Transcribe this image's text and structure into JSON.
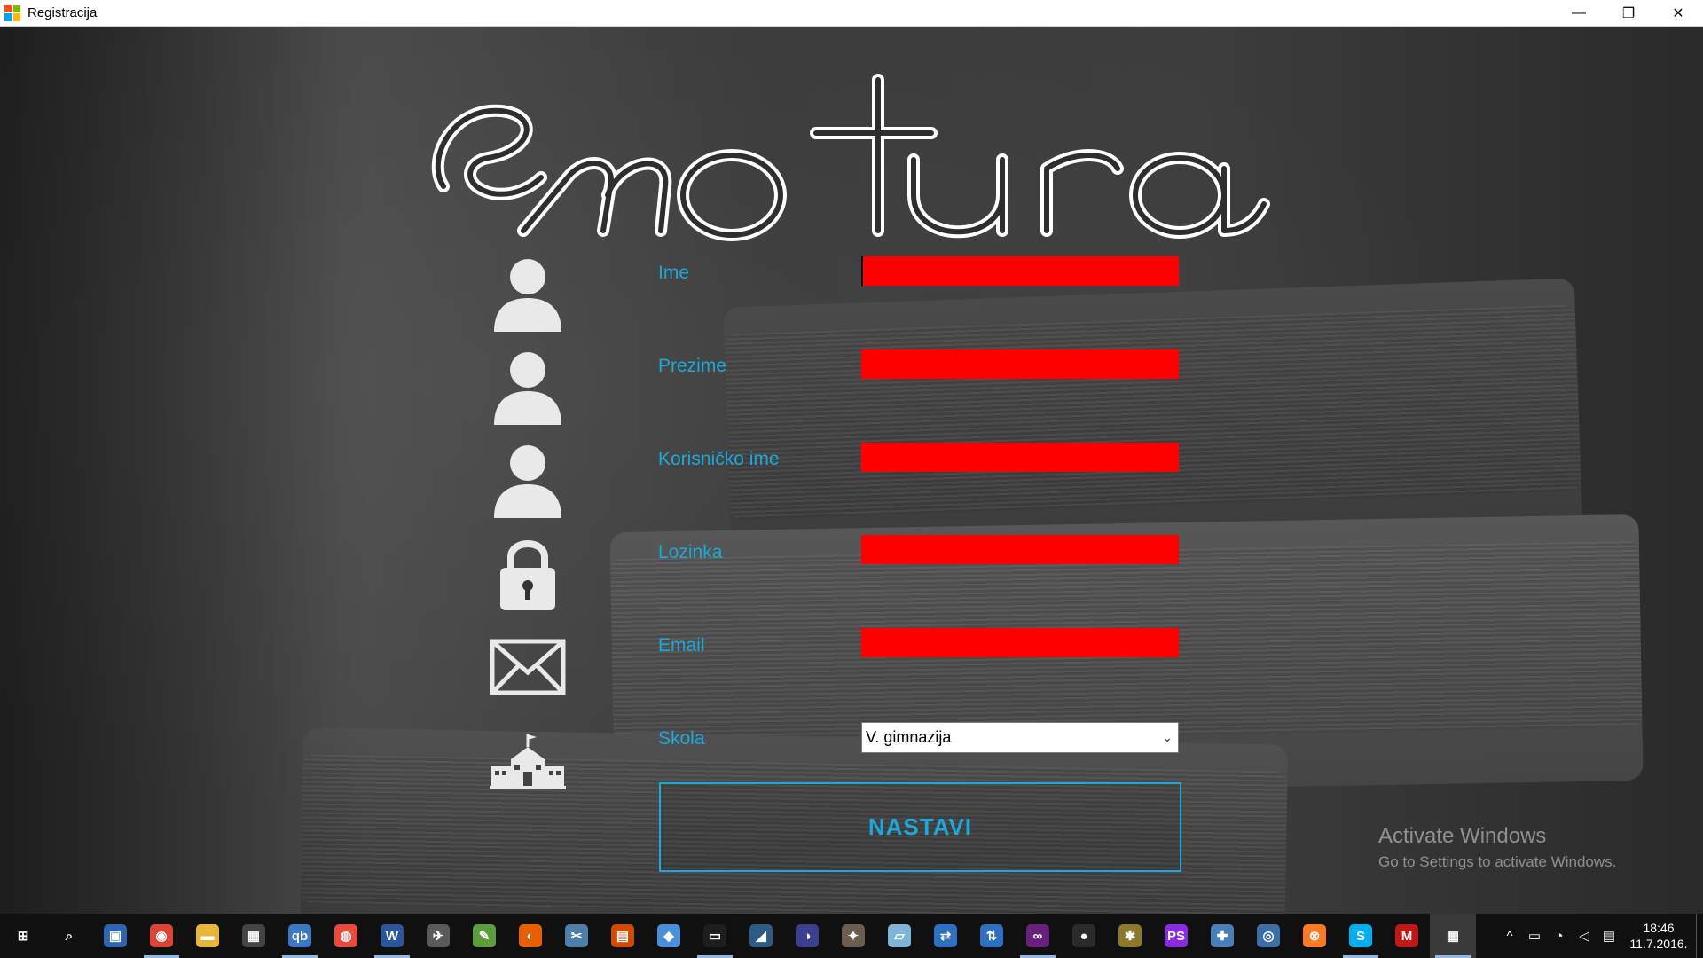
{
  "window": {
    "title": "Registracija",
    "controls": {
      "minimize": "—",
      "restore": "❐",
      "close": "✕"
    }
  },
  "logo": {
    "text": "ematura"
  },
  "form": {
    "fields": [
      {
        "label": "Ime",
        "value": "",
        "icon": "user-icon"
      },
      {
        "label": "Prezime",
        "value": "",
        "icon": "user-icon"
      },
      {
        "label": "Korisničko ime",
        "value": "",
        "icon": "user-icon"
      },
      {
        "label": "Lozinka",
        "value": "",
        "icon": "lock-icon"
      },
      {
        "label": "Email",
        "value": "",
        "icon": "mail-icon"
      }
    ],
    "school": {
      "label": "Skola",
      "selected": "V. gimnazija",
      "icon": "school-icon"
    },
    "submit_label": "NASTAVI",
    "field_color": "#ff0000",
    "accent_color": "#1da8d9"
  },
  "watermark": {
    "line1": "Activate Windows",
    "line2": "Go to Settings to activate Windows."
  },
  "taskbar": {
    "apps": [
      {
        "name": "start-button",
        "glyph": "⊞",
        "color": "#101010"
      },
      {
        "name": "search-icon",
        "glyph": "⌕",
        "color": "#101010"
      },
      {
        "name": "virtualbox-icon",
        "glyph": "▣",
        "color": "#2f64b0"
      },
      {
        "name": "chrome-icon",
        "glyph": "◉",
        "color": "#db4437"
      },
      {
        "name": "file-explorer-icon",
        "glyph": "▬",
        "color": "#e8b73a"
      },
      {
        "name": "calculator-icon",
        "glyph": "▦",
        "color": "#444444"
      },
      {
        "name": "qbittorrent-icon",
        "glyph": "qb",
        "color": "#3b78c5"
      },
      {
        "name": "app-red-icon",
        "glyph": "◍",
        "color": "#e64b3c"
      },
      {
        "name": "word-icon",
        "glyph": "W",
        "color": "#2b579a"
      },
      {
        "name": "app-satellite-icon",
        "glyph": "✈",
        "color": "#5a5a5a"
      },
      {
        "name": "notepad-plus-icon",
        "glyph": "✎",
        "color": "#5c9e3a"
      },
      {
        "name": "firefox-icon",
        "glyph": "◐",
        "color": "#e66000"
      },
      {
        "name": "snipping-icon",
        "glyph": "✂",
        "color": "#4f7fa8"
      },
      {
        "name": "office-icon",
        "glyph": "▤",
        "color": "#d04a02"
      },
      {
        "name": "cube-icon",
        "glyph": "◆",
        "color": "#4a90d9"
      },
      {
        "name": "terminal-icon",
        "glyph": "▭",
        "color": "#1e1e1e"
      },
      {
        "name": "mysql-icon",
        "glyph": "◢",
        "color": "#2c5b85"
      },
      {
        "name": "eclipse-icon",
        "glyph": "◑",
        "color": "#3c3f8e"
      },
      {
        "name": "gimp-icon",
        "glyph": "✦",
        "color": "#6b5d4f"
      },
      {
        "name": "app-paper-icon",
        "glyph": "▱",
        "color": "#7fb5d8"
      },
      {
        "name": "network-icon",
        "glyph": "⇄",
        "color": "#2e6fc2"
      },
      {
        "name": "network2-icon",
        "glyph": "⇅",
        "color": "#2e6fc2"
      },
      {
        "name": "visual-studio-icon",
        "glyph": "∞",
        "color": "#68217a"
      },
      {
        "name": "github-icon",
        "glyph": "●",
        "color": "#2b2b2b"
      },
      {
        "name": "tool-icon",
        "glyph": "✱",
        "color": "#8a7a2a"
      },
      {
        "name": "phpstorm-icon",
        "glyph": "PS",
        "color": "#8a2be2"
      },
      {
        "name": "puzzle-icon",
        "glyph": "✚",
        "color": "#4a7fb8"
      },
      {
        "name": "globe-app-icon",
        "glyph": "◎",
        "color": "#3c6fa8"
      },
      {
        "name": "xampp-icon",
        "glyph": "⊗",
        "color": "#fb7a24"
      },
      {
        "name": "skype-icon",
        "glyph": "S",
        "color": "#00aff0"
      },
      {
        "name": "mcafee-icon",
        "glyph": "M",
        "color": "#c01818"
      },
      {
        "name": "registracija-app-icon",
        "glyph": "▦",
        "color": "#3a3a3a"
      }
    ],
    "tray": {
      "chevron": "^",
      "battery": "▭",
      "wifi": "◔",
      "volume": "◁",
      "notification": "▤"
    },
    "clock": {
      "time": "18:46",
      "date": "11.7.2016."
    }
  }
}
